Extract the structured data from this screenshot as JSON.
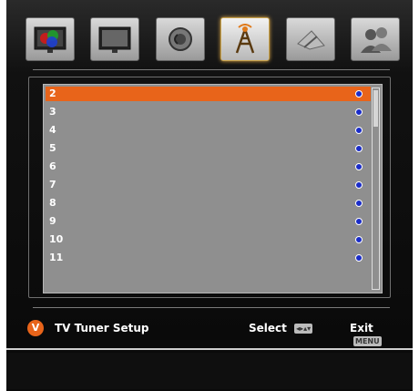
{
  "tabs": [
    {
      "name": "picture",
      "icon": "tv-picture-icon"
    },
    {
      "name": "display",
      "icon": "monitor-icon"
    },
    {
      "name": "audio",
      "icon": "speaker-icon"
    },
    {
      "name": "tuner",
      "icon": "antenna-icon"
    },
    {
      "name": "satellite",
      "icon": "satellite-dish-icon"
    },
    {
      "name": "users",
      "icon": "users-icon"
    }
  ],
  "list": {
    "rows": [
      {
        "label": "2",
        "selected": true
      },
      {
        "label": "3"
      },
      {
        "label": "4"
      },
      {
        "label": "5"
      },
      {
        "label": "6"
      },
      {
        "label": "7"
      },
      {
        "label": "8"
      },
      {
        "label": "9"
      },
      {
        "label": "10"
      },
      {
        "label": "11"
      }
    ]
  },
  "footer": {
    "title": "TV Tuner Setup",
    "select_label": "Select",
    "select_key": "◂▸▴▾",
    "exit_label": "Exit",
    "exit_key": "MENU",
    "logo_letter": "V"
  },
  "colors": {
    "highlight": "#e8641a",
    "radio": "#1a2cc9"
  }
}
